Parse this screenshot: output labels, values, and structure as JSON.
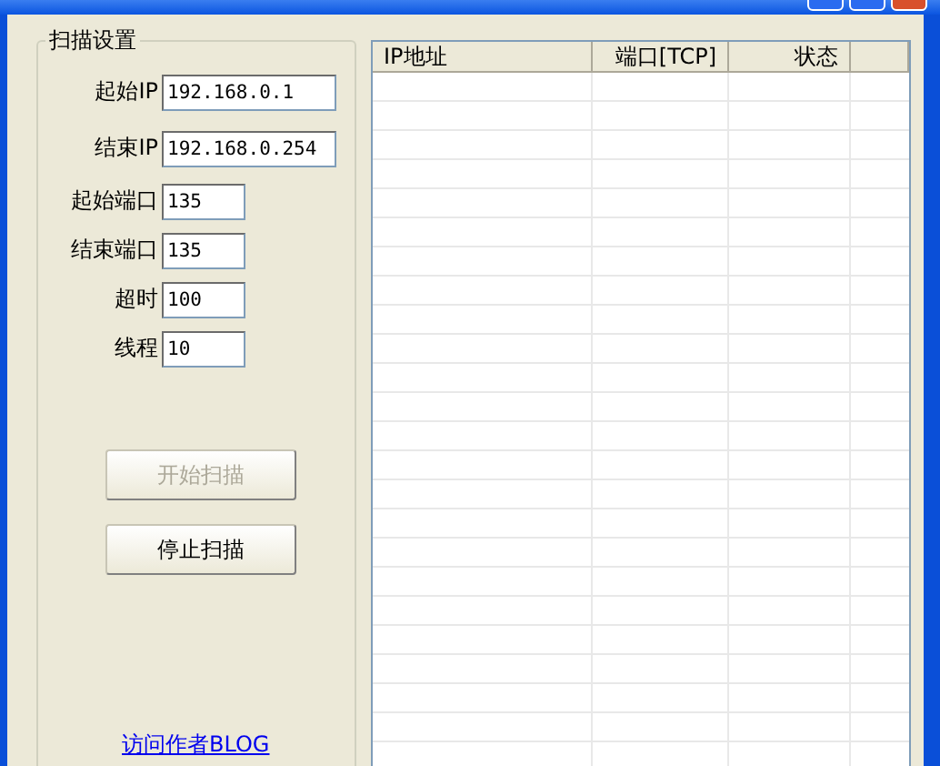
{
  "scan_settings": {
    "title": "扫描设置",
    "fields": [
      {
        "label": "起始IP",
        "value": "192.168.0.1",
        "wide": true
      },
      {
        "label": "结束IP",
        "value": "192.168.0.254",
        "wide": true
      },
      {
        "label": "起始端口",
        "value": "135",
        "wide": false
      },
      {
        "label": "结束端口",
        "value": "135",
        "wide": false
      },
      {
        "label": "超时",
        "value": "100",
        "wide": false
      },
      {
        "label": "线程",
        "value": "10",
        "wide": false
      }
    ],
    "buttons": [
      {
        "label": "开始扫描",
        "disabled": true
      },
      {
        "label": "停止扫描",
        "disabled": false
      }
    ],
    "link": "访问作者BLOG"
  },
  "table": {
    "columns": [
      "IP地址",
      "端口[TCP]",
      "状态"
    ]
  }
}
